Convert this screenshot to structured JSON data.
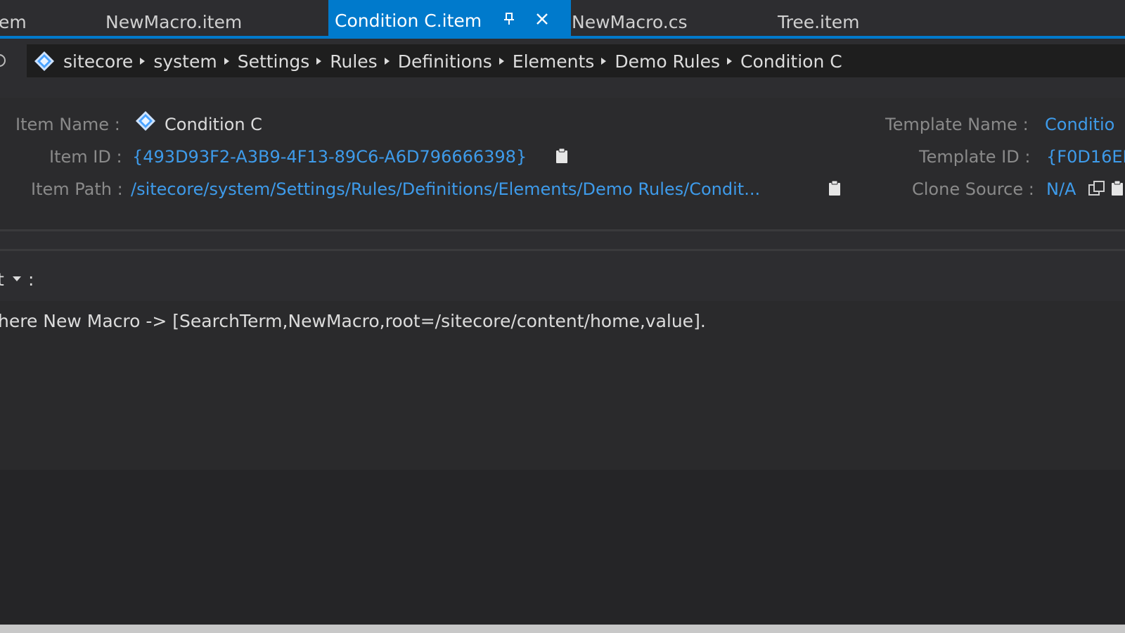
{
  "tabs": [
    {
      "label": "em",
      "active": false
    },
    {
      "label": "NewMacro.item",
      "active": false
    },
    {
      "label": "Condition C.item",
      "active": true
    },
    {
      "label": "NewMacro.cs",
      "active": false
    },
    {
      "label": "Tree.item",
      "active": false
    }
  ],
  "breadcrumb": {
    "items": [
      "sitecore",
      "system",
      "Settings",
      "Rules",
      "Definitions",
      "Elements",
      "Demo Rules",
      "Condition C"
    ]
  },
  "properties": {
    "item_name_label": "Item Name :",
    "item_name_value": "Condition C",
    "item_id_label": "Item ID :",
    "item_id_value": "{493D93F2-A3B9-4F13-89C6-A6D796666398}",
    "item_path_label": "Item Path :",
    "item_path_value": "/sitecore/system/Settings/Rules/Definitions/Elements/Demo Rules/Condit...",
    "template_name_label": "Template Name :",
    "template_name_value": "Conditio",
    "template_id_label": "Template ID :",
    "template_id_value": "{F0D16EE",
    "clone_source_label": "Clone Source :",
    "clone_source_value": "N/A"
  },
  "section": {
    "title": "t",
    "colon": ":",
    "rule_text": "here New Macro -> [SearchTerm,NewMacro,root=/sitecore/content/home,value]."
  },
  "colors": {
    "accent": "#007acc",
    "link": "#3e9bea",
    "background": "#2d2d30"
  }
}
